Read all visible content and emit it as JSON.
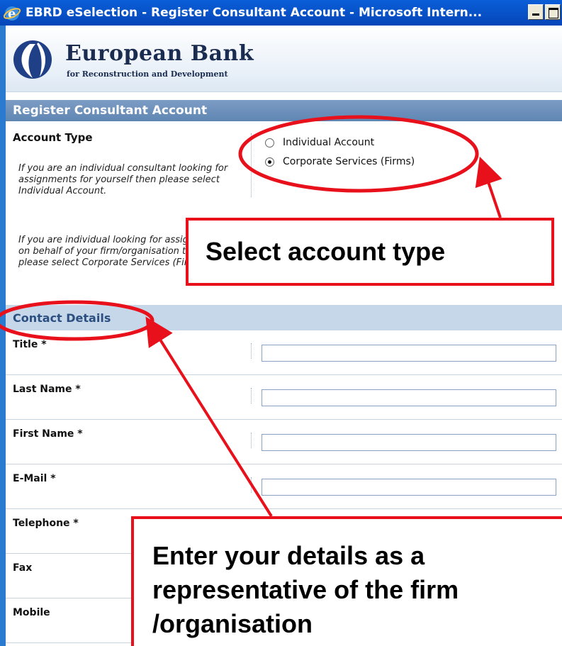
{
  "window": {
    "title": "EBRD eSelection - Register Consultant Account - Microsoft Intern..."
  },
  "header": {
    "brand_title": "European Bank",
    "brand_subtitle": "for Reconstruction and Development"
  },
  "account_section": {
    "heading": "Register Consultant Account",
    "account_type_label": "Account Type",
    "help_individual": "If you are an individual consultant looking for assignments for yourself then please select Individual Account.",
    "help_corporate": "If you are individual looking for assignments on behalf of your firm/organisation then please select Corporate Services (Firms).",
    "options": [
      {
        "label": "Individual Account",
        "selected": false
      },
      {
        "label": "Corporate Services (Firms)",
        "selected": true
      }
    ]
  },
  "contact_section": {
    "heading": "Contact Details",
    "fields": [
      {
        "label": "Title *",
        "value": ""
      },
      {
        "label": "Last Name *",
        "value": ""
      },
      {
        "label": "First Name *",
        "value": ""
      },
      {
        "label": "E-Mail *",
        "value": ""
      },
      {
        "label": "Telephone *",
        "value": ""
      },
      {
        "label": "Fax",
        "value": ""
      },
      {
        "label": "Mobile",
        "value": ""
      }
    ]
  },
  "annotations": {
    "callout_account": "Select account type",
    "callout_details_line1": "Enter your details as a",
    "callout_details_line2": "representative of the firm",
    "callout_details_line3": "/organisation"
  },
  "colors": {
    "annotation_red": "#e8101a",
    "section_bar_blue": "#6a8fb8",
    "titlebar_blue": "#0546b8"
  }
}
